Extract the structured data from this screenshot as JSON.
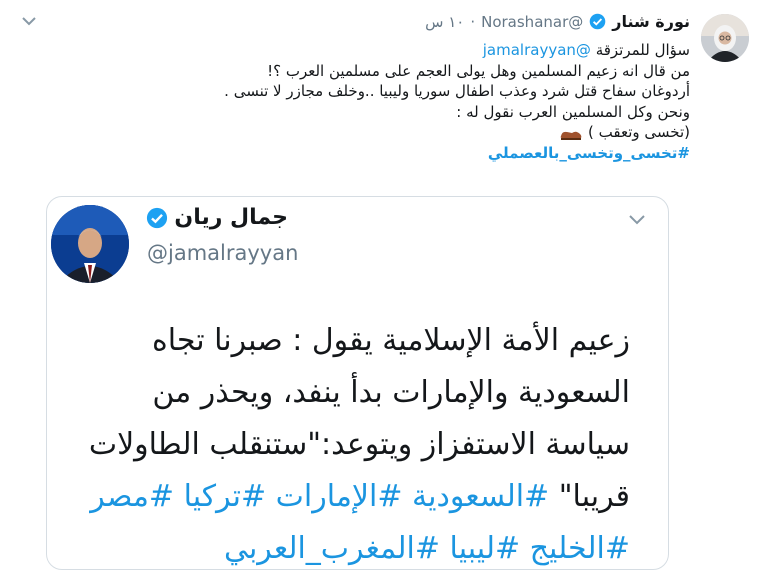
{
  "tweet": {
    "author_name": "نورة شنار",
    "author_handle": "@Norashanar",
    "dot": "·",
    "time": "١٠ س",
    "reply_prefix": "سؤال للمرتزقة",
    "reply_mention": "@jamalrayyan",
    "lines": [
      "من قال انه زعيم المسلمين وهل يولى العجم على مسلمين العرب ؟!",
      "أردوغان سفاح قتل شرد وعذب اطفال سوريا وليبيا ..وخلف مجازر لا تنسى .",
      "ونحن وكل المسلمين العرب نقول له :"
    ],
    "last_line": "(تخسى وتعقب )",
    "hashtag": "#تخسى_وتخسى_بالعصملي",
    "icons": {
      "menu": "chevron-down-icon",
      "verified": "verified-badge-icon",
      "shoe": "shoe-emoji-icon"
    }
  },
  "quoted": {
    "author_name": "جمال ريان",
    "author_handle": "@jamalrayyan",
    "line1": "زعيم الأمة الإسلامية يقول : صبرنا تجاه",
    "line2": "السعودية والإمارات بدأ ينفد، ويحذر من",
    "line3": "سياسة الاستفزاز ويتوعد:\"ستنقلب الطاولات",
    "line4_text": "قريبا\"",
    "line4_tags": "#السعودية #الإمارات #تركيا #مصر",
    "line5_tags": "#الخليج #ليبيا #المغرب_العربي"
  },
  "colors": {
    "link": "#1b95e0",
    "text": "#14171a",
    "muted": "#657786",
    "border": "#d6dde3"
  }
}
